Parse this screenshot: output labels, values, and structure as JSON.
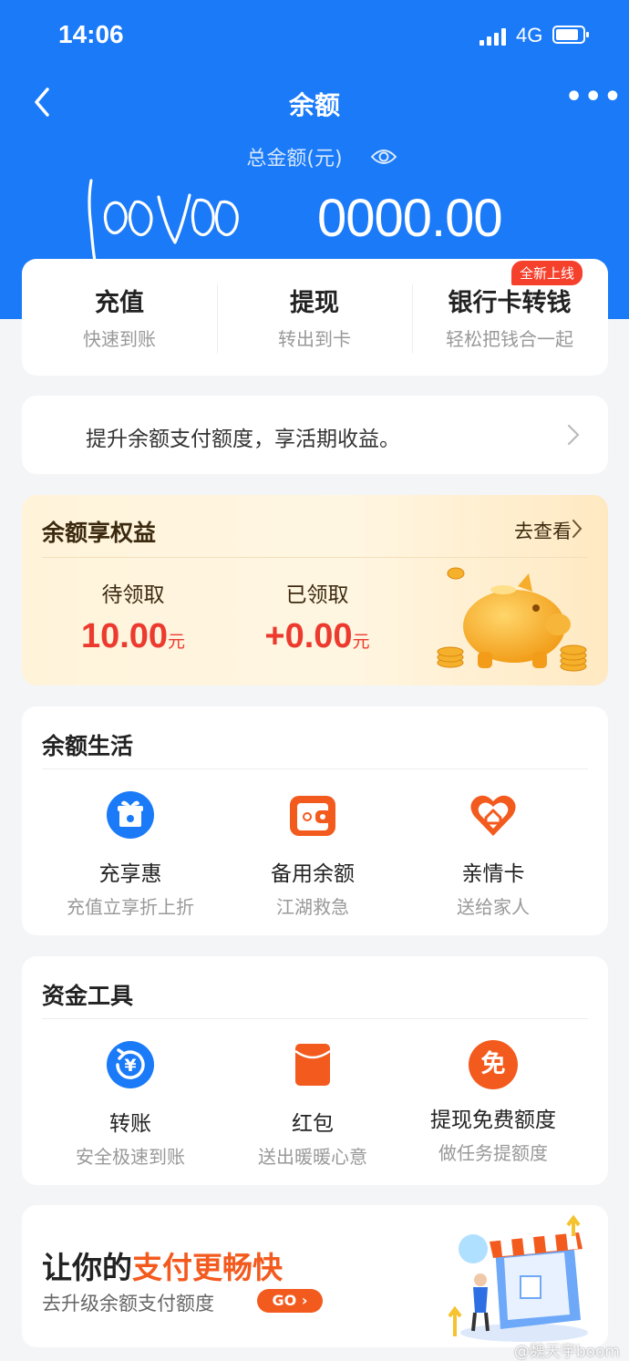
{
  "status_bar": {
    "time": "14:06",
    "network": "4G"
  },
  "nav": {
    "title": "余额"
  },
  "balance": {
    "label": "总金额(元)",
    "amount_handwritten": "100",
    "amount_tail": "0000.00"
  },
  "actions": [
    {
      "title": "充值",
      "subtitle": "快速到账"
    },
    {
      "title": "提现",
      "subtitle": "转出到卡"
    },
    {
      "title": "银行卡转钱",
      "subtitle": "轻松把钱合一起",
      "badge": "全新上线"
    }
  ],
  "promo": {
    "text": "提升余额支付额度，享活期收益。"
  },
  "benefits": {
    "title": "余额享权益",
    "link": "去查看",
    "pending_label": "待领取",
    "pending_value": "10.00",
    "received_label": "已领取",
    "received_value": "+0.00",
    "unit": "元"
  },
  "life": {
    "title": "余额生活",
    "items": [
      {
        "title": "充享惠",
        "subtitle": "充值立享折上折",
        "icon": "gift-icon"
      },
      {
        "title": "备用余额",
        "subtitle": "江湖救急",
        "icon": "wallet-icon"
      },
      {
        "title": "亲情卡",
        "subtitle": "送给家人",
        "icon": "heart-home-icon"
      }
    ]
  },
  "tools": {
    "title": "资金工具",
    "items": [
      {
        "title": "转账",
        "subtitle": "安全极速到账",
        "icon": "yuan-transfer-icon"
      },
      {
        "title": "红包",
        "subtitle": "送出暖暖心意",
        "icon": "red-envelope-icon"
      },
      {
        "title": "提现免费额度",
        "subtitle": "做任务提额度",
        "icon": "free-badge-icon",
        "icon_text": "免"
      }
    ]
  },
  "banner": {
    "title_prefix": "让你的",
    "title_highlight": "支付更畅快",
    "subtitle": "去升级余额支付额度",
    "button": "GO"
  },
  "watermark": "@魏天宇boom",
  "colors": {
    "brand_blue": "#1a7af8",
    "accent_orange": "#f35a1e",
    "value_red": "#ec3a2f"
  }
}
